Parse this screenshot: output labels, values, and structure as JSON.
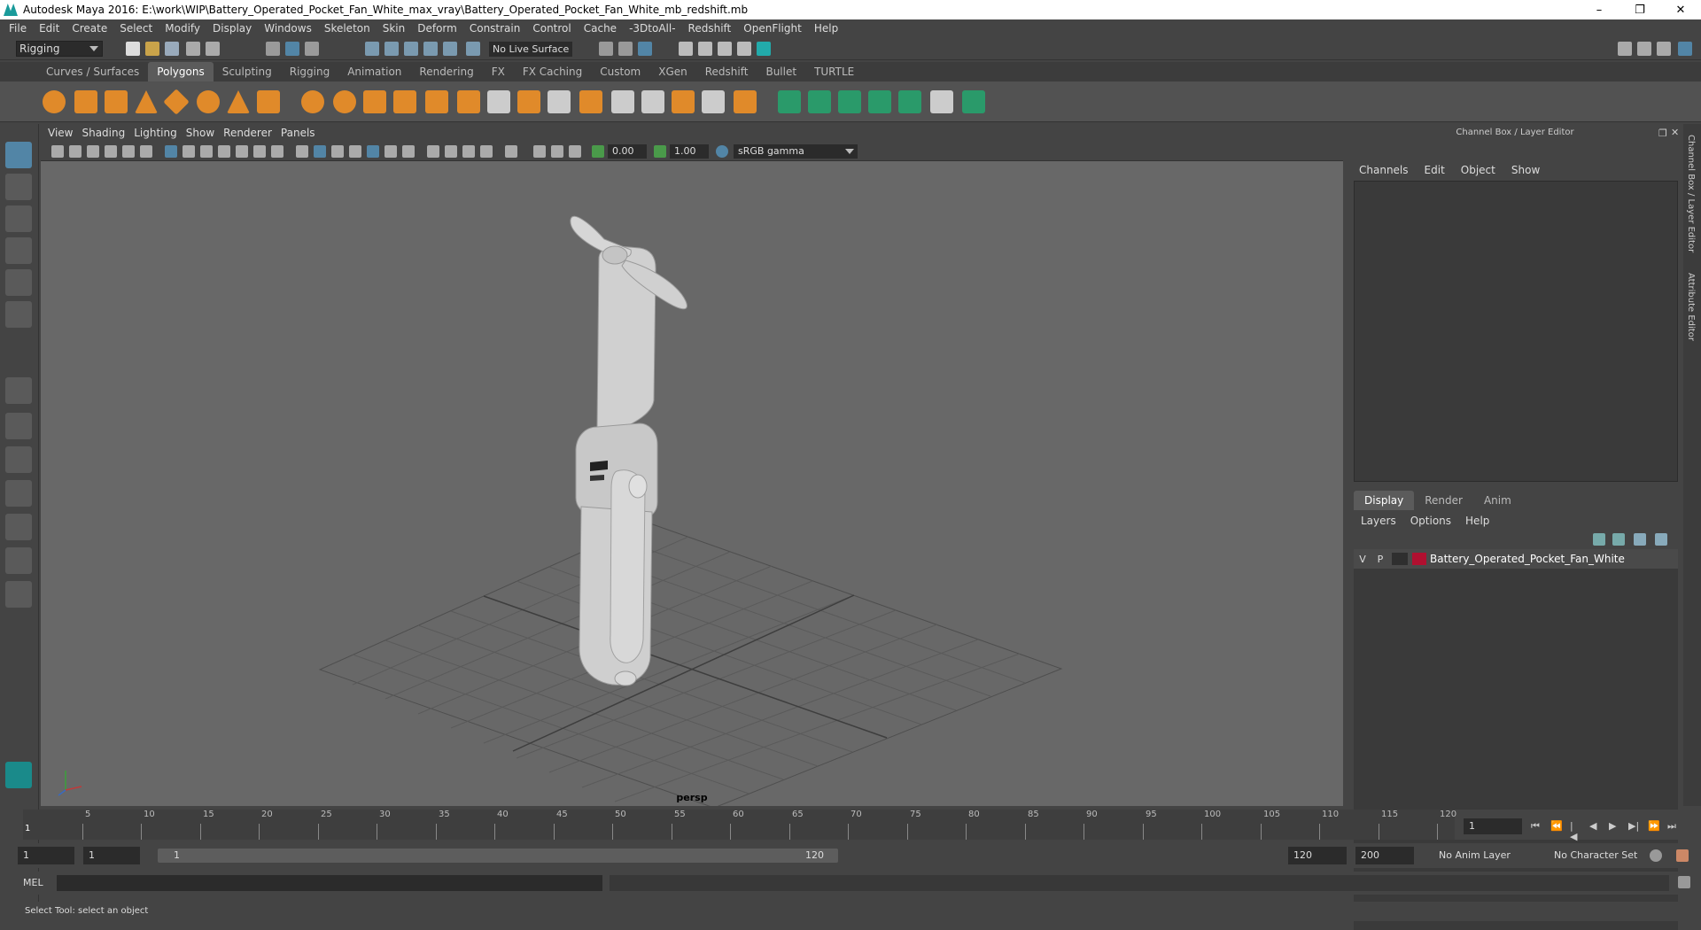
{
  "window": {
    "title": "Autodesk Maya 2016: E:\\work\\WIP\\Battery_Operated_Pocket_Fan_White_max_vray\\Battery_Operated_Pocket_Fan_White_mb_redshift.mb",
    "controls": [
      "–",
      "❐",
      "✕"
    ]
  },
  "menubar": [
    "File",
    "Edit",
    "Create",
    "Select",
    "Modify",
    "Display",
    "Windows",
    "Skeleton",
    "Skin",
    "Deform",
    "Constrain",
    "Control",
    "Cache",
    "-3DtoAll-",
    "Redshift",
    "OpenFlight",
    "Help"
  ],
  "statusline": {
    "mode": "Rigging",
    "live_surface": "No Live Surface"
  },
  "shelf_tabs": [
    "Curves / Surfaces",
    "Polygons",
    "Sculpting",
    "Rigging",
    "Animation",
    "Rendering",
    "FX",
    "FX Caching",
    "Custom",
    "XGen",
    "Redshift",
    "Bullet",
    "TURTLE"
  ],
  "shelf_active": "Polygons",
  "viewport": {
    "menu": [
      "View",
      "Shading",
      "Lighting",
      "Show",
      "Renderer",
      "Panels"
    ],
    "exposure": "0.00",
    "gamma": "1.00",
    "color_space": "sRGB gamma",
    "camera_label": "persp"
  },
  "right_panel": {
    "title": "Channel Box / Layer Editor",
    "channel_menu": [
      "Channels",
      "Edit",
      "Object",
      "Show"
    ],
    "layer_tabs": [
      "Display",
      "Render",
      "Anim"
    ],
    "layer_tab_active": "Display",
    "layer_menu": [
      "Layers",
      "Options",
      "Help"
    ],
    "layers": [
      {
        "v": "V",
        "p": "P",
        "color": "#b01030",
        "name": "Battery_Operated_Pocket_Fan_White"
      }
    ],
    "side_tabs": [
      "Channel Box / Layer Editor",
      "Attribute Editor"
    ]
  },
  "timeline": {
    "ticks": [
      "5",
      "10",
      "15",
      "20",
      "25",
      "30",
      "35",
      "40",
      "45",
      "50",
      "55",
      "60",
      "65",
      "70",
      "75",
      "80",
      "85",
      "90",
      "95",
      "100",
      "105",
      "110",
      "115",
      "120"
    ],
    "start_label": "1",
    "current_frame": "1"
  },
  "range": {
    "start": "1",
    "playback_start": "1",
    "slider_start": "1",
    "slider_end": "120",
    "playback_end": "120",
    "end": "200",
    "anim_layer": "No Anim Layer",
    "character_set": "No Character Set"
  },
  "command": {
    "label": "MEL"
  },
  "help_line": "Select Tool: select an object"
}
